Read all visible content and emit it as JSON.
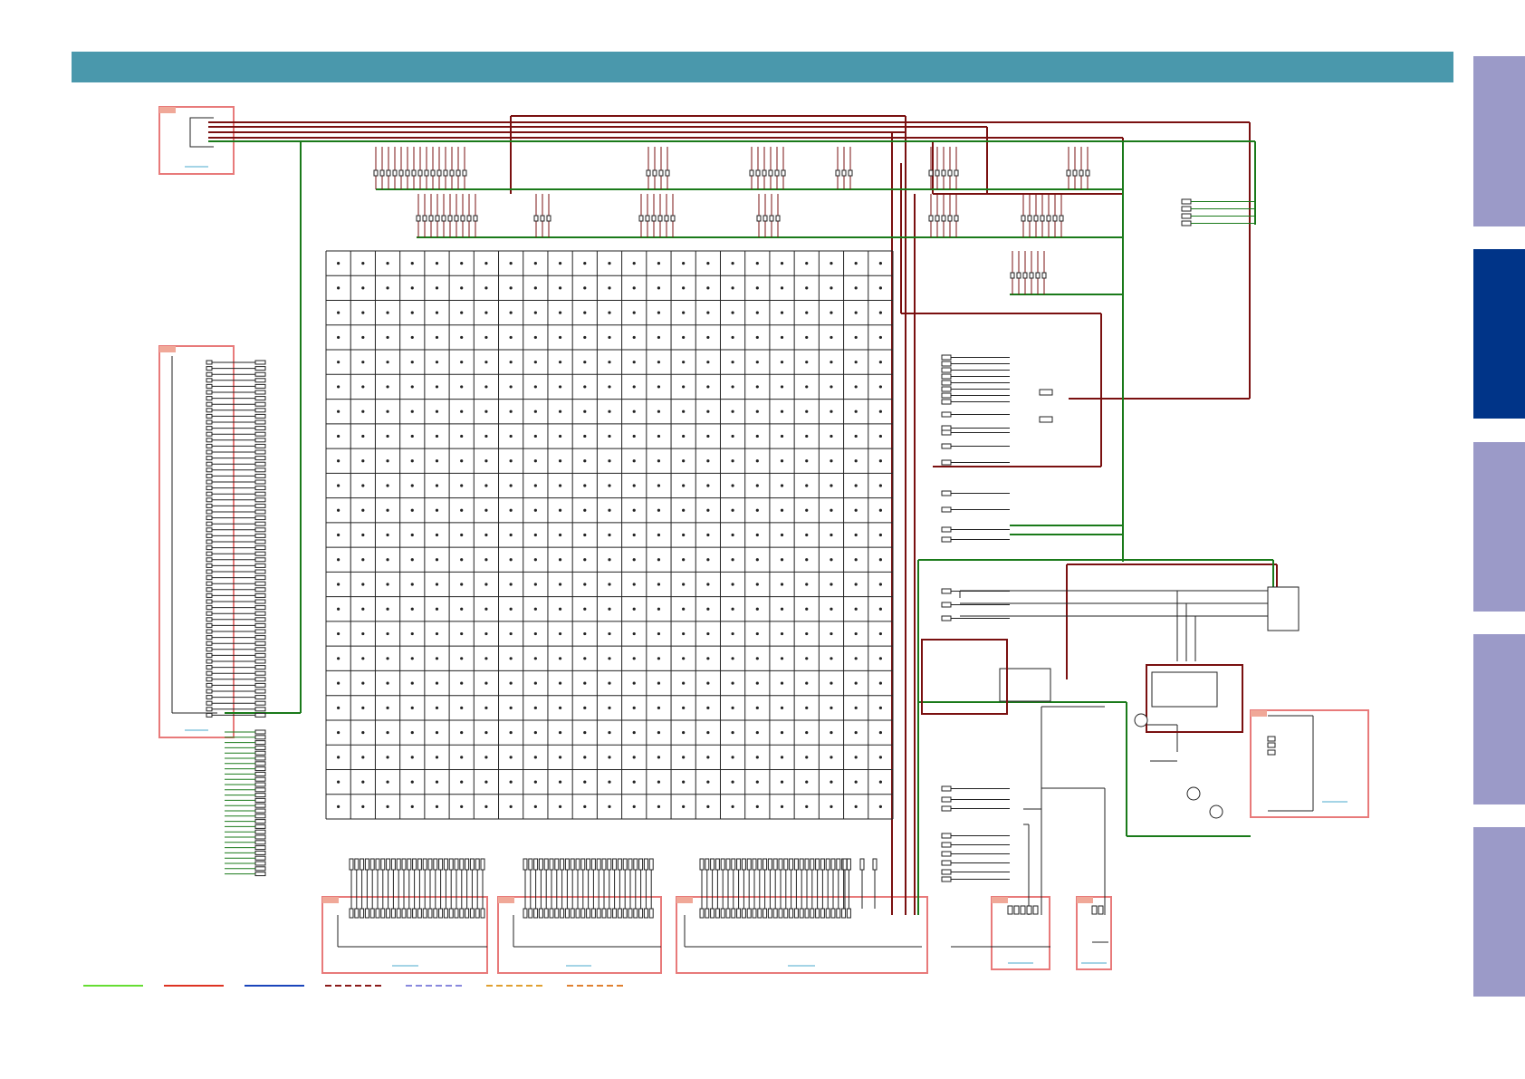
{
  "header": {
    "color": "#4a98ac"
  },
  "side_tabs": [
    {
      "id": "tab-1",
      "active": false
    },
    {
      "id": "tab-2",
      "active": true
    },
    {
      "id": "tab-3",
      "active": false
    },
    {
      "id": "tab-4",
      "active": false
    },
    {
      "id": "tab-5",
      "active": false
    }
  ],
  "colors": {
    "tab_inactive": "#9b9ac8",
    "tab_active": "#003488",
    "wire_green": "#1a7a1a",
    "wire_red": "#7a1010",
    "box_outline": "#e87a7a",
    "grid_line": "#222222"
  },
  "legend": [
    {
      "color": "#66dd33",
      "style": "solid"
    },
    {
      "color": "#dd3322",
      "style": "solid"
    },
    {
      "color": "#1a44bb",
      "style": "solid"
    },
    {
      "color": "#8a1a1a",
      "style": "dashed"
    },
    {
      "color": "#8888dd",
      "style": "dashed"
    },
    {
      "color": "#e0a030",
      "style": "dashed"
    },
    {
      "color": "#e08030",
      "style": "dashed"
    }
  ],
  "led_matrix": {
    "rows": 23,
    "cols": 23
  }
}
